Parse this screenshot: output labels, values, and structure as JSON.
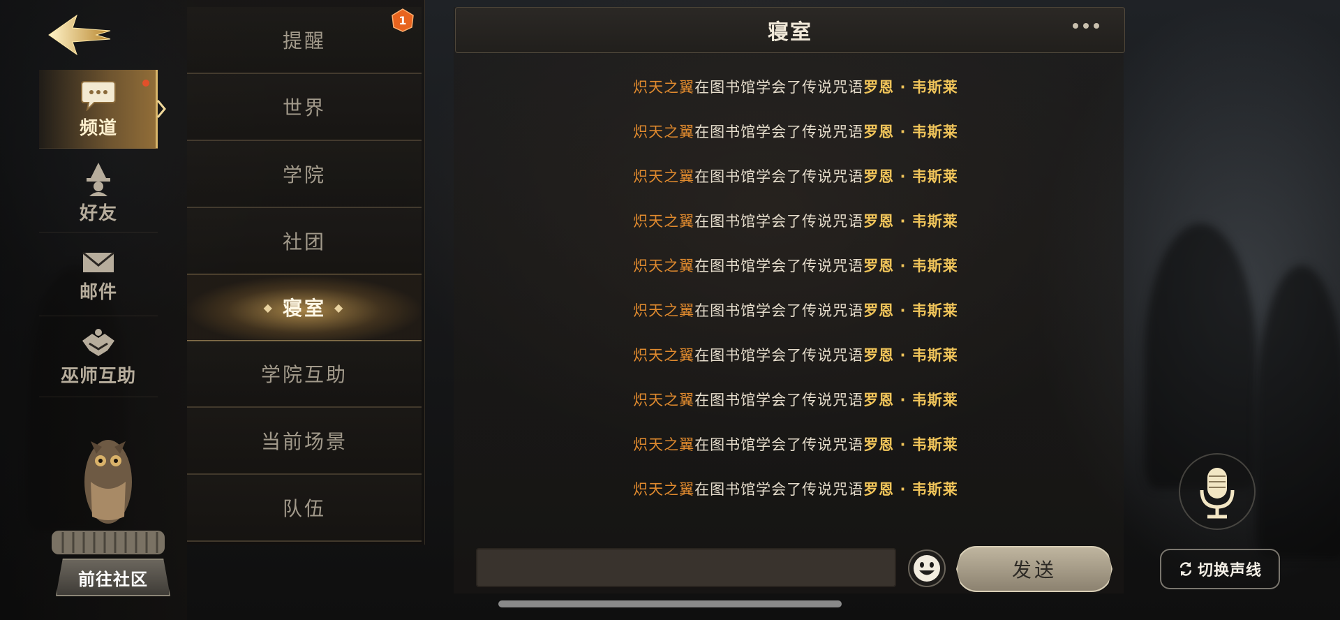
{
  "left_rail": {
    "items": [
      {
        "label": "频道",
        "icon": "chat-bubble-icon",
        "active": true
      },
      {
        "label": "好友",
        "icon": "wizard-hat-icon",
        "active": false
      },
      {
        "label": "邮件",
        "icon": "envelope-icon",
        "active": false
      },
      {
        "label": "巫师互助",
        "icon": "handshake-icon",
        "active": false
      }
    ],
    "community_label": "前往社区"
  },
  "channels": {
    "badge_count": "1",
    "items": [
      {
        "label": "提醒",
        "active": false
      },
      {
        "label": "世界",
        "active": false
      },
      {
        "label": "学院",
        "active": false
      },
      {
        "label": "社团",
        "active": false
      },
      {
        "label": "寝室",
        "active": true
      },
      {
        "label": "学院互助",
        "active": false
      },
      {
        "label": "当前场景",
        "active": false
      },
      {
        "label": "队伍",
        "active": false
      }
    ]
  },
  "chat": {
    "title": "寝室",
    "messages": [
      {
        "player": "炽天之翼",
        "text": "在图书馆学会了传说咒语",
        "spell": "罗恩 · 韦斯莱"
      },
      {
        "player": "炽天之翼",
        "text": "在图书馆学会了传说咒语",
        "spell": "罗恩 · 韦斯莱"
      },
      {
        "player": "炽天之翼",
        "text": "在图书馆学会了传说咒语",
        "spell": "罗恩 · 韦斯莱"
      },
      {
        "player": "炽天之翼",
        "text": "在图书馆学会了传说咒语",
        "spell": "罗恩 · 韦斯莱"
      },
      {
        "player": "炽天之翼",
        "text": "在图书馆学会了传说咒语",
        "spell": "罗恩 · 韦斯莱"
      },
      {
        "player": "炽天之翼",
        "text": "在图书馆学会了传说咒语",
        "spell": "罗恩 · 韦斯莱"
      },
      {
        "player": "炽天之翼",
        "text": "在图书馆学会了传说咒语",
        "spell": "罗恩 · 韦斯莱"
      },
      {
        "player": "炽天之翼",
        "text": "在图书馆学会了传说咒语",
        "spell": "罗恩 · 韦斯莱"
      },
      {
        "player": "炽天之翼",
        "text": "在图书馆学会了传说咒语",
        "spell": "罗恩 · 韦斯莱"
      },
      {
        "player": "炽天之翼",
        "text": "在图书馆学会了传说咒语",
        "spell": "罗恩 · 韦斯莱"
      }
    ],
    "input_value": "",
    "send_label": "发送"
  },
  "voice": {
    "switch_label": "切换声线"
  },
  "colors": {
    "player_name": "#e08a2e",
    "spell_name": "#f0c45a",
    "accent_gold": "#d8b56a",
    "badge_orange": "#e8641f"
  }
}
